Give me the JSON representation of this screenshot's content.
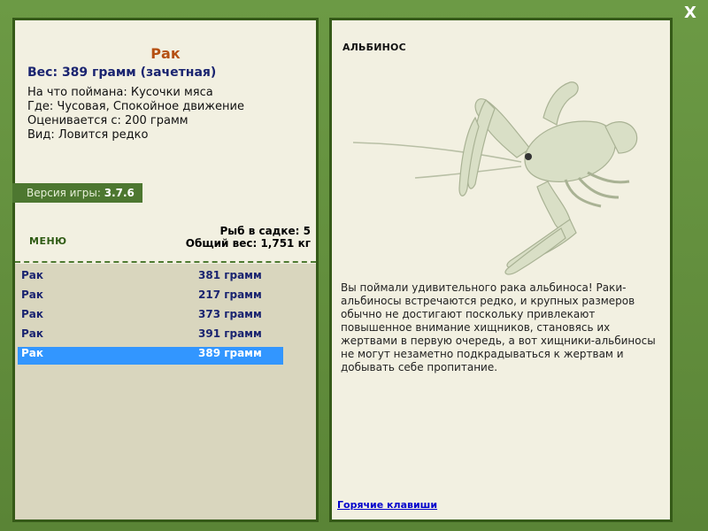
{
  "window": {
    "close_label": "X"
  },
  "fish": {
    "name": "Рак",
    "weight_line": "Вес: 389 грамм (зачетная)",
    "caught_on": "На что поймана: Кусочки мяса",
    "location": "Где: Чусовая, Спокойное движение",
    "valued_from": "Оценивается с: 200 грамм",
    "species_rarity": "Вид: Ловится редко"
  },
  "version": {
    "label": "Версия игры:",
    "value": "3.7.6"
  },
  "menu_label": "МЕНЮ",
  "stats": {
    "fish_in_keepnet": "Рыб в садке: 5",
    "total_weight": "Общий вес: 1,751 кг"
  },
  "catch": [
    {
      "name": "Рак",
      "weight": "381 грамм"
    },
    {
      "name": "Рак",
      "weight": "217 грамм"
    },
    {
      "name": "Рак",
      "weight": "373 грамм"
    },
    {
      "name": "Рак",
      "weight": "391 грамм"
    },
    {
      "name": "Рак",
      "weight": "389 грамм"
    }
  ],
  "albino": {
    "title": "АЛЬБИНОС",
    "description": "Вы поймали удивительного рака альбиноса! Раки-альбиносы встречаются редко, и крупных размеров обычно не достигают поскольку привлекают повышенное внимание хищников, становясь их жертвами в первую очередь, а вот хищники-альбиносы не могут незаметно подкрадываться к жертвам и добывать себе пропитание."
  },
  "hotkeys_link": "Горячие клавиши",
  "colors": {
    "frame": "#5f8a3a",
    "panel": "#f2f0e1",
    "selected_row": "#3296ff",
    "title_accent": "#b55012"
  }
}
